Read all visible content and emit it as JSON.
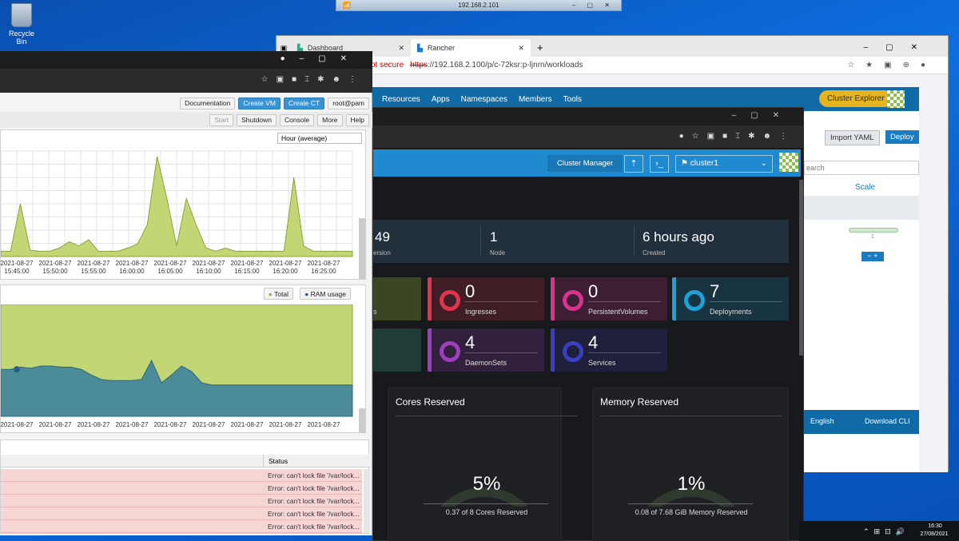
{
  "desktop": {
    "recycle_label": "Recycle Bin"
  },
  "rdp": {
    "title": "192.168.2.101"
  },
  "edge": {
    "tabs": [
      {
        "label": "Dashboard"
      },
      {
        "label": "Rancher"
      }
    ],
    "not_secure": "ot secure",
    "url_scheme": "https",
    "url_rest": "://192.168.2.100/p/c-72ksr:p-ljnrn/workloads",
    "nav": [
      "Resources",
      "Apps",
      "Namespaces",
      "Members",
      "Tools"
    ],
    "cluster_explorer": "Cluster Explorer",
    "import_yaml": "Import YAML",
    "deploy": "Deploy",
    "search_placeholder": "earch",
    "scale_header": "Scale",
    "scale_value": "1",
    "english": "English",
    "download_cli": "Download CLI"
  },
  "pve": {
    "toolbar": {
      "documentation": "Documentation",
      "create_vm": "Create VM",
      "create_ct": "Create CT",
      "user": "root@pam"
    },
    "actions": {
      "start": "Start",
      "shutdown": "Shutdown",
      "console": "Console",
      "more": "More",
      "help": "Help"
    },
    "timeframe": "Hour (average)",
    "cpu_chart_ticks": [
      "2021-08-27\n15:45:00",
      "2021-08-27\n15:50:00",
      "2021-08-27\n15:55:00",
      "2021-08-27\n16:00:00",
      "2021-08-27\n16:05:00",
      "2021-08-27\n16:10:00",
      "2021-08-27\n16:15:00",
      "2021-08-27\n16:20:00",
      "2021-08-27\n16:25:00"
    ],
    "ram_legend": {
      "total": "Total",
      "ram_usage": "RAM usage"
    },
    "ram_ticks": [
      "2021-08-27",
      "2021-08-27",
      "2021-08-27",
      "2021-08-27",
      "2021-08-27",
      "2021-08-27",
      "2021-08-27",
      "2021-08-27",
      "2021-08-27"
    ],
    "tasks": {
      "status_header": "Status",
      "rows": [
        "Error: can't lock file '/var/lock...",
        "Error: can't lock file '/var/lock...",
        "Error: can't lock file '/var/lock...",
        "Error: can't lock file '/var/lock...",
        "Error: can't lock file '/var/lock..."
      ]
    }
  },
  "dark": {
    "cluster_manager": "Cluster Manager",
    "cluster_name": "cluster1",
    "stats": [
      {
        "value": "49",
        "label": "ersion"
      },
      {
        "value": "1",
        "label": "Node"
      },
      {
        "value": "6 hours ago",
        "label": "Created"
      }
    ],
    "tiles": [
      {
        "value": "0",
        "label": "Ingresses",
        "color": "#e0344d"
      },
      {
        "value": "0",
        "label": "PersistentVolumes",
        "color": "#d8348f"
      },
      {
        "value": "7",
        "label": "Deployments",
        "color": "#1ea0d8"
      },
      {
        "value": "4",
        "label": "DaemonSets",
        "color": "#9b3fc0"
      },
      {
        "value": "4",
        "label": "Services",
        "color": "#3a3ec0"
      }
    ],
    "cores": {
      "title": "Cores Reserved",
      "percent": "5%",
      "caption": "0.37 of 8 Cores Reserved",
      "fraction": 0.05
    },
    "memory": {
      "title": "Memory Reserved",
      "percent": "1%",
      "caption": "0.08 of 7.68 GiB Memory Reserved",
      "fraction": 0.01
    }
  },
  "taskbar": {
    "time": "16:30",
    "date": "27/08/2021"
  },
  "chart_data": [
    {
      "type": "area",
      "series": [
        {
          "values": [
            0.05,
            0.05,
            0.5,
            0.06,
            0.05,
            0.05,
            0.08,
            0.14,
            0.1,
            0.16,
            0.05,
            0.05,
            0.05,
            0.08,
            0.12,
            0.3,
            0.95,
            0.55,
            0.1,
            0.55,
            0.3,
            0.08,
            0.05,
            0.08,
            0.05,
            0.05,
            0.05,
            0.05,
            0.05,
            0.05,
            0.75,
            0.1,
            0.05,
            0.05,
            0.05,
            0.05,
            0.05
          ]
        }
      ],
      "x": [
        "2021-08-27 15:45:00",
        "2021-08-27 15:50:00",
        "2021-08-27 15:55:00",
        "2021-08-27 16:00:00",
        "2021-08-27 16:05:00",
        "2021-08-27 16:10:00",
        "2021-08-27 16:15:00",
        "2021-08-27 16:20:00",
        "2021-08-27 16:25:00"
      ]
    },
    {
      "type": "area",
      "series": [
        {
          "name": "Total",
          "values": [
            1,
            1,
            1,
            1,
            1,
            1,
            1,
            1,
            1,
            1,
            1,
            1,
            1,
            1,
            1,
            1,
            1,
            1,
            1,
            1,
            1,
            1,
            1,
            1,
            1,
            1,
            1,
            1,
            1,
            1,
            1,
            1,
            1,
            1,
            1,
            1
          ]
        },
        {
          "name": "RAM usage",
          "values": [
            0.42,
            0.42,
            0.44,
            0.43,
            0.45,
            0.45,
            0.44,
            0.44,
            0.42,
            0.37,
            0.33,
            0.32,
            0.32,
            0.32,
            0.33,
            0.5,
            0.3,
            0.37,
            0.45,
            0.4,
            0.3,
            0.28,
            0.28,
            0.28,
            0.28,
            0.28,
            0.28,
            0.28,
            0.28,
            0.28,
            0.28,
            0.28,
            0.28,
            0.28,
            0.28,
            0.28
          ]
        }
      ],
      "x": [
        "2021-08-27",
        "2021-08-27",
        "2021-08-27",
        "2021-08-27",
        "2021-08-27",
        "2021-08-27",
        "2021-08-27",
        "2021-08-27",
        "2021-08-27"
      ]
    }
  ]
}
